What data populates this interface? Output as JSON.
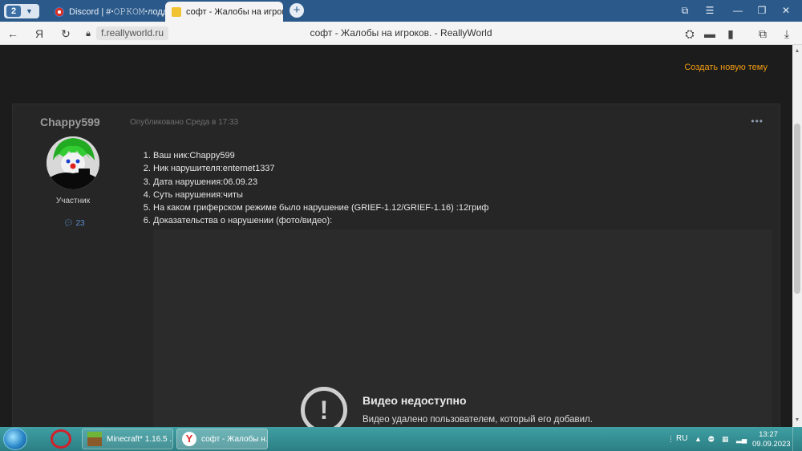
{
  "browser": {
    "tab_count": "2",
    "tabs": [
      {
        "title": "Discord | #ꞏ𝙾𝙿𝙺𝙾𝙼ꞏлоддк"
      },
      {
        "title": "софт - Жалобы на игрок",
        "active": true
      }
    ],
    "url": "f.reallyworld.ru",
    "page_title": "софт - Жалобы на игроков. - ReallyWorld"
  },
  "forum": {
    "create_topic": "Создать новую тему",
    "post": {
      "author": "Chappy599",
      "posted": "Опубликовано Среда в 17:33",
      "more": "•••",
      "role": "Участник",
      "post_count": "23",
      "lines": [
        "Ваш ник:Chappy599",
        "Ник нарушителя:enternet1337",
        "Дата нарушения:06.09.23",
        "Суть нарушения:читы",
        "На каком гриферском режиме было нарушение (GRIEF-1.12/GRIEF-1.16) :12гриф",
        "Доказательства о нарушении (фото/видео):"
      ],
      "video": {
        "title": "Видео недоступно",
        "subtitle": "Видео удалено пользователем, который его добавил."
      }
    }
  },
  "taskbar": {
    "items": [
      {
        "label": "Minecraft* 1.16.5 ..."
      },
      {
        "label": "софт - Жалобы н..."
      }
    ],
    "lang": "RU",
    "time": "13:27",
    "date": "09.09.2023"
  },
  "colors": {
    "accent_link": "#f39c12",
    "background": "#1c1c1c",
    "post_bg": "#262626",
    "tab_strip": "#2b5a8a"
  }
}
